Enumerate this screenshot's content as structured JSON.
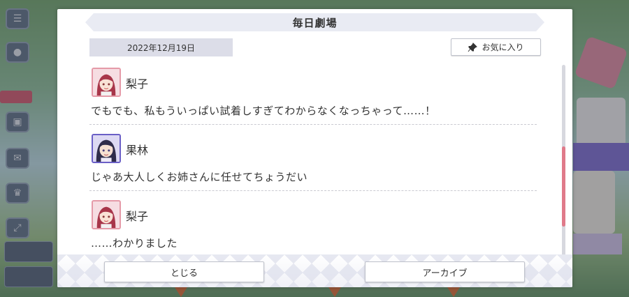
{
  "dialog": {
    "title": "毎日劇場",
    "date": "2022年12月19日",
    "favorite_label": "お気に入り",
    "close_label": "とじる",
    "archive_label": "アーカイブ"
  },
  "entries": [
    {
      "speaker": "梨子",
      "avatar": "riko-avatar",
      "text": "でもでも、私もういっぱい試着しすぎてわからなくなっちゃって……！"
    },
    {
      "speaker": "果林",
      "avatar": "karin-avatar",
      "text": "じゃあ大人しくお姉さんに任せてちょうだい"
    },
    {
      "speaker": "梨子",
      "avatar": "riko-avatar",
      "text": "……わかりました"
    }
  ],
  "scroll": {
    "position": 0.55
  },
  "colors": {
    "accent": "#e07a8a",
    "riko_frame": "#e59aa8",
    "karin_frame": "#6a5fc6",
    "title_bar": "#e9ebf3",
    "date_box": "#dcdde8"
  },
  "icons": [
    "pin-icon",
    "menu-icon",
    "chat-icon",
    "gift-icon",
    "trophy-icon",
    "expand-icon"
  ]
}
